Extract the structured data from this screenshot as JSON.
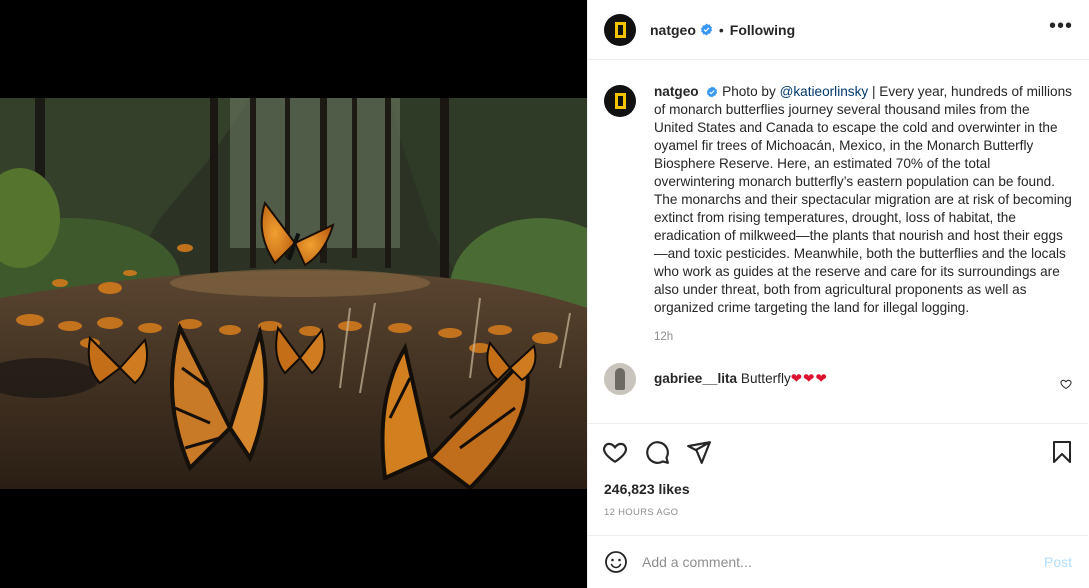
{
  "header": {
    "username": "natgeo",
    "separator": "•",
    "follow_status": "Following",
    "more_icon": "more-horizontal-icon"
  },
  "caption": {
    "username": "natgeo",
    "prefix": "Photo by",
    "mention": "@katieorlinsky",
    "text": "| Every year, hundreds of millions of monarch butterflies journey several thousand miles from the United States and Canada to escape the cold and overwinter in the oyamel fir trees of Michoacán, Mexico, in the Monarch Butterfly Biosphere Reserve. Here, an estimated 70% of the total overwintering monarch butterfly’s eastern population can be found. The monarchs and their spectacular migration are at risk of becoming extinct from rising temperatures, drought, loss of habitat, the eradication of milkweed—the plants that nourish and host their eggs—and toxic pesticides. Meanwhile, both the butterflies and the locals who work as guides at the reserve and care for its surroundings are also under threat, both from agricultural proponents as well as organized crime targeting the land for illegal logging.",
    "time": "12h"
  },
  "comment": {
    "username": "gabriee__lita",
    "text": "Butterfly",
    "hearts": "❤❤❤"
  },
  "actions": {
    "like_icon": "heart-icon",
    "comment_icon": "comment-icon",
    "share_icon": "paper-plane-icon",
    "save_icon": "bookmark-icon"
  },
  "stats": {
    "likes": "246,823 likes",
    "posted": "12 HOURS AGO"
  },
  "add_comment": {
    "placeholder": "Add a comment...",
    "post_label": "Post"
  },
  "colors": {
    "verified": "#3897f0",
    "link": "#00376b",
    "heart": "#e0102f",
    "post_disabled": "#b2dffc",
    "natgeo_yellow": "#f5c400"
  }
}
